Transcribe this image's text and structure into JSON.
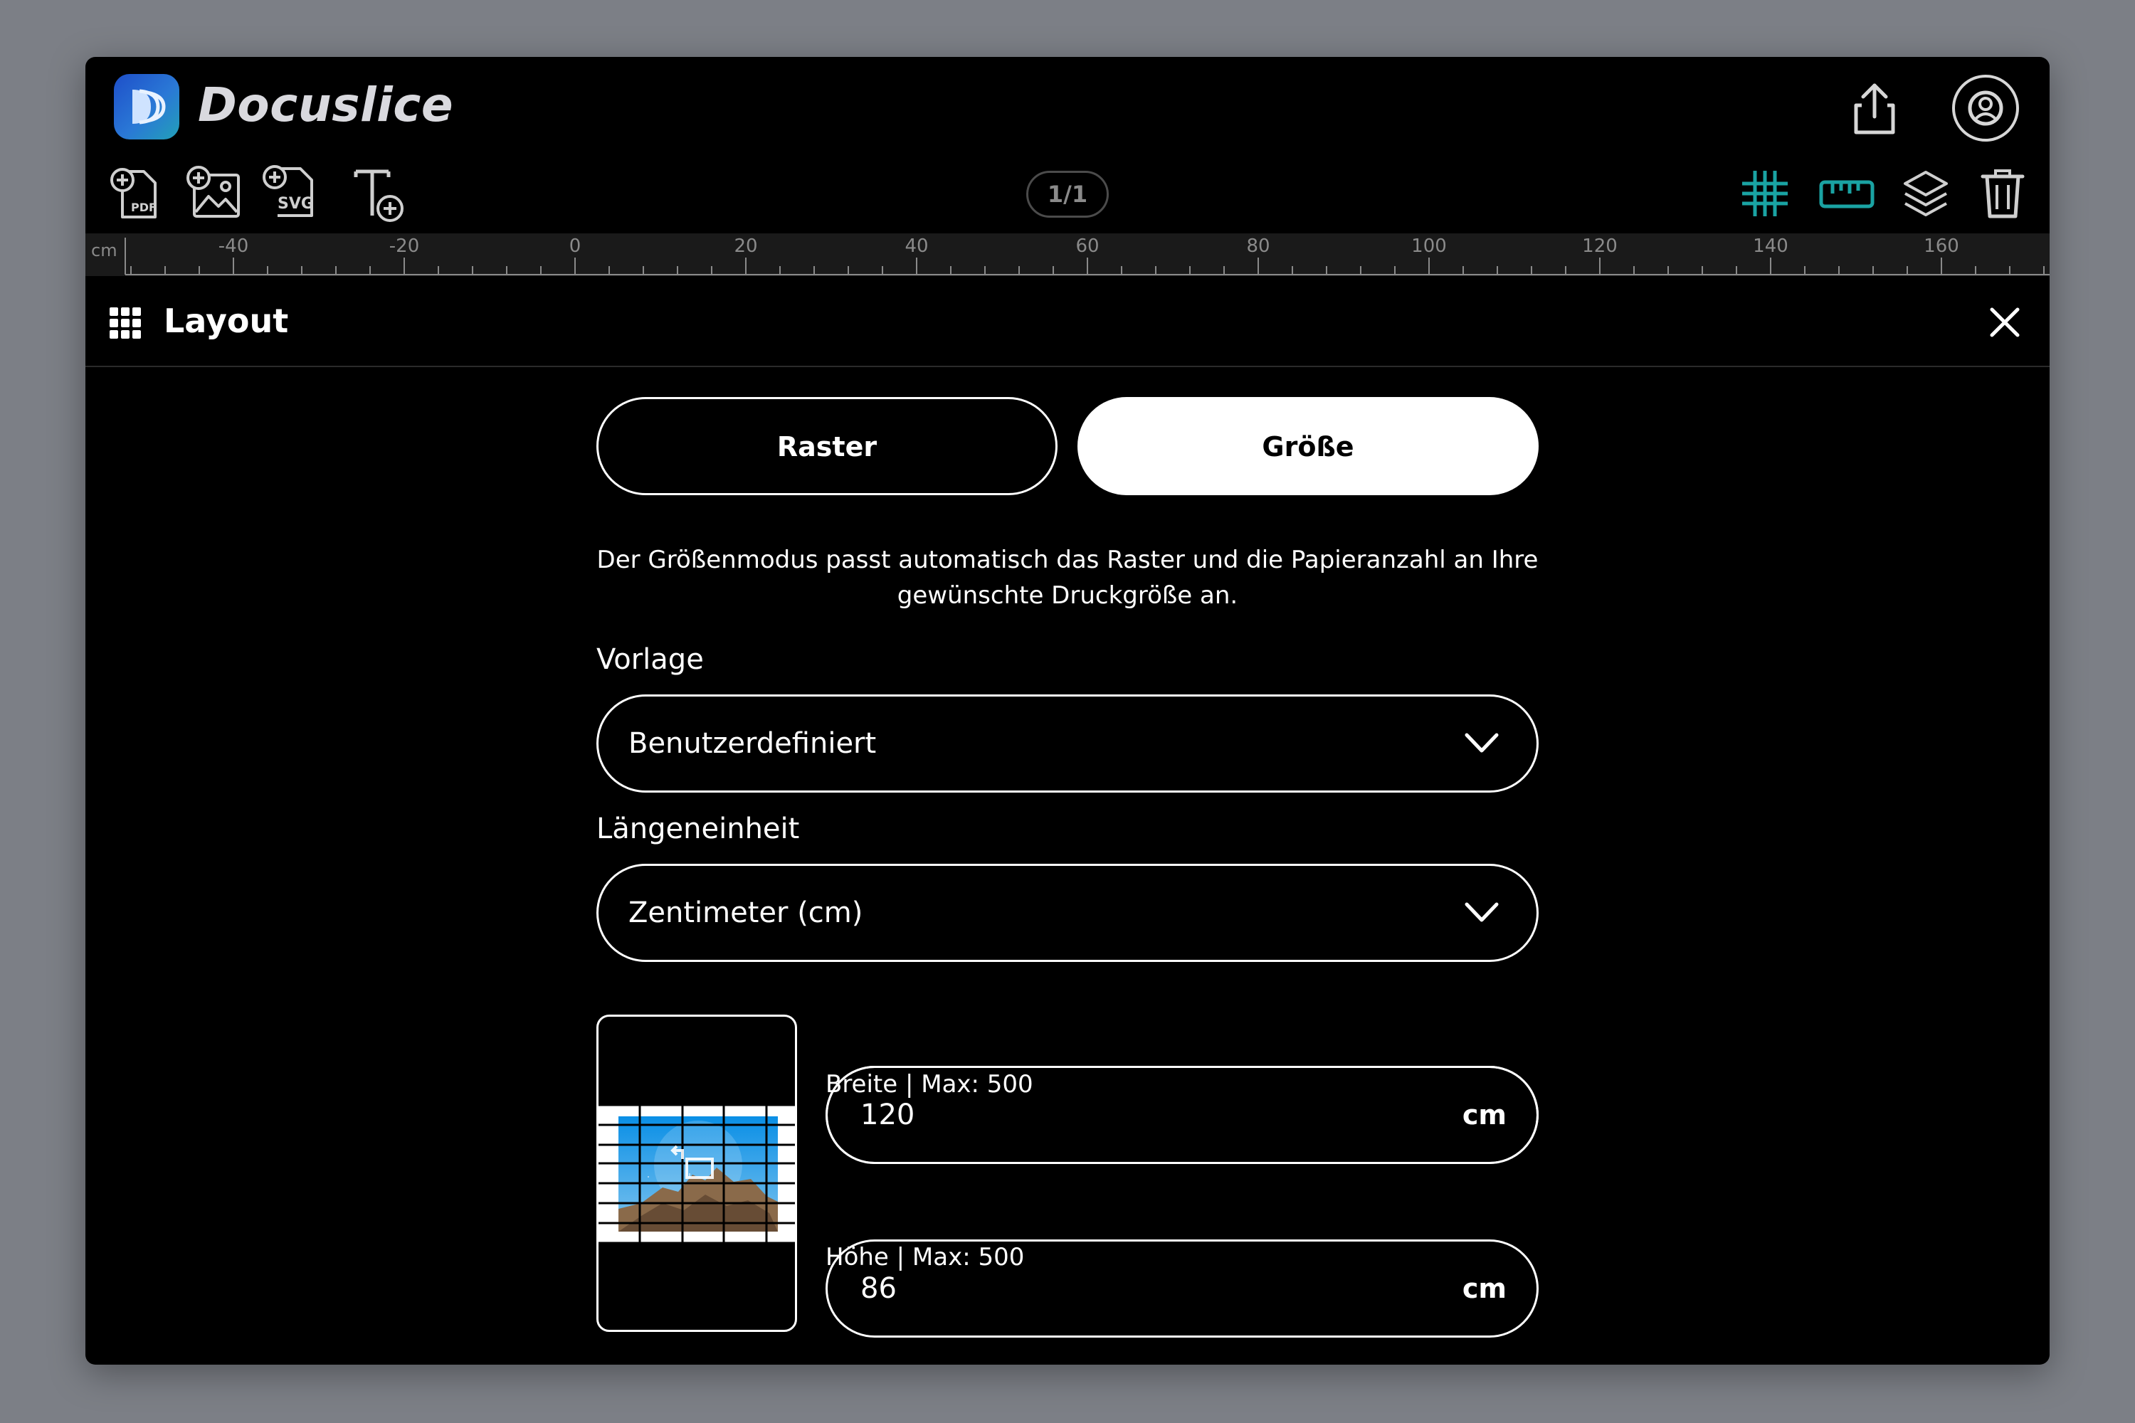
{
  "app": {
    "title": "Docuslice"
  },
  "header": {
    "share_icon": "share-icon",
    "account_icon": "account-icon"
  },
  "toolbar": {
    "add_pdf_icon": "add-pdf-icon",
    "pdf_badge": "PDF",
    "add_image_icon": "add-image-icon",
    "add_svg_icon": "add-svg-icon",
    "svg_badge": "SVG",
    "add_text_icon": "add-text-icon",
    "page_indicator": "1/1",
    "grid_icon": "grid-icon",
    "ruler_icon": "ruler-icon",
    "layers_icon": "layers-icon",
    "trash_icon": "trash-icon",
    "accent_color": "#1aa3a3"
  },
  "ruler": {
    "unit": "cm",
    "labels": [
      "-40",
      "-20",
      "0",
      "20",
      "40",
      "60",
      "80",
      "100",
      "120",
      "140",
      "160"
    ]
  },
  "panel": {
    "title": "Layout",
    "modes": {
      "raster": "Raster",
      "size": "Größe",
      "active": "size"
    },
    "description": "Der Größenmodus passt automatisch das Raster und die Papieranzahl an Ihre gewünschte Druckgröße an.",
    "template_label": "Vorlage",
    "template_value": "Benutzerdefiniert",
    "unit_label": "Längeneinheit",
    "unit_value": "Zentimeter (cm)",
    "width_label": "Breite | Max: 500",
    "width_value": "120",
    "width_unit": "cm",
    "height_label": "Höhe | Max: 500",
    "height_value": "86",
    "height_unit": "cm"
  }
}
